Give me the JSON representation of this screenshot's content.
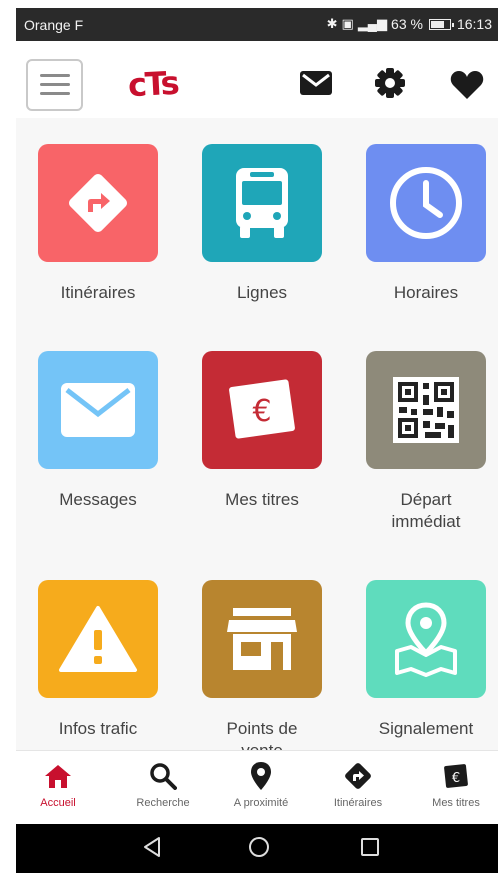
{
  "status_bar": {
    "carrier": "Orange F",
    "battery": "63 %",
    "time": "16:13"
  },
  "app_bar": {
    "logo": "cTs",
    "icons": [
      "menu-icon",
      "mail-icon",
      "gear-icon",
      "heart-icon"
    ]
  },
  "tiles": [
    {
      "label": "Itinéraires",
      "color": "#f86468",
      "icon": "directions-icon"
    },
    {
      "label": "Lignes",
      "color": "#1fa6b8",
      "icon": "bus-icon"
    },
    {
      "label": "Horaires",
      "color": "#6e8ef1",
      "icon": "clock-icon"
    },
    {
      "label": "Messages",
      "color": "#74c4f7",
      "icon": "envelope-icon"
    },
    {
      "label": "Mes titres",
      "color": "#c42b35",
      "icon": "euro-ticket-icon"
    },
    {
      "label": "Départ\nimmédiat",
      "color": "#8e8a7a",
      "icon": "qr-code-icon"
    },
    {
      "label": "Infos trafic",
      "color": "#f6ab1c",
      "icon": "warning-icon"
    },
    {
      "label": "Points de\nvente",
      "color": "#b8852f",
      "icon": "store-icon"
    },
    {
      "label": "Signalement",
      "color": "#5fdcbd",
      "icon": "map-pin-icon"
    }
  ],
  "bottom_nav": [
    {
      "label": "Accueil",
      "icon": "home-icon",
      "active": true
    },
    {
      "label": "Recherche",
      "icon": "search-icon",
      "active": false
    },
    {
      "label": "A proximité",
      "icon": "location-pin-icon",
      "active": false
    },
    {
      "label": "Itinéraires",
      "icon": "directions-icon",
      "active": false
    },
    {
      "label": "Mes titres",
      "icon": "euro-ticket-icon",
      "active": false
    }
  ],
  "colors": {
    "brand": "#c8102e",
    "status_bar": "#2a2a2a",
    "system_nav": "#000000"
  }
}
